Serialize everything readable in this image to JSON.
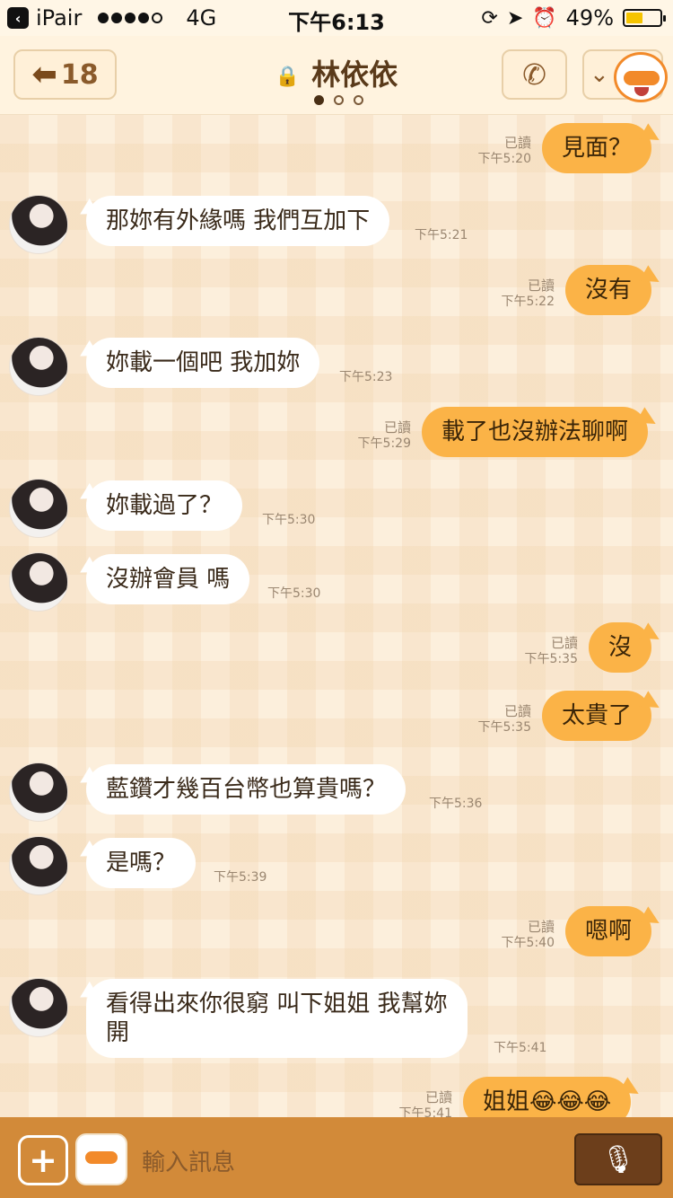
{
  "status_bar": {
    "back_app": "iPair",
    "carrier_network": "4G",
    "time": "下午6:13",
    "battery_percent": "49%",
    "battery_level": 0.49
  },
  "header": {
    "back_count": "18",
    "title": "林依依",
    "icons": {
      "back": "back-arrow-icon",
      "call": "phone-icon",
      "more": "chevron-down-icon",
      "lock": "lock-icon"
    }
  },
  "messages": [
    {
      "side": "out",
      "text": "見面？",
      "status": "已讀",
      "time": "下午5:20"
    },
    {
      "side": "in",
      "text": "那妳有外緣嗎  我們互加下",
      "time": "下午5:21"
    },
    {
      "side": "out",
      "text": "沒有",
      "status": "已讀",
      "time": "下午5:22"
    },
    {
      "side": "in",
      "text": "妳載一個吧 我加妳",
      "time": "下午5:23"
    },
    {
      "side": "out",
      "text": "載了也沒辦法聊啊",
      "status": "已讀",
      "time": "下午5:29"
    },
    {
      "side": "in",
      "text": "妳載過了？",
      "time": "下午5:30"
    },
    {
      "side": "in",
      "text": "沒辦會員 嗎",
      "time": "下午5:30"
    },
    {
      "side": "out",
      "text": "沒",
      "status": "已讀",
      "time": "下午5:35"
    },
    {
      "side": "out",
      "text": "太貴了",
      "status": "已讀",
      "time": "下午5:35"
    },
    {
      "side": "in",
      "text": "藍鑽才幾百台幣也算貴嗎？",
      "time": "下午5:36"
    },
    {
      "side": "in",
      "text": "是嗎？",
      "time": "下午5:39"
    },
    {
      "side": "out",
      "text": "嗯啊",
      "status": "已讀",
      "time": "下午5:40"
    },
    {
      "side": "in",
      "text_line1": "看得出來你很窮  叫下姐姐 我幫妳",
      "text_line2": "開",
      "time": "下午5:41"
    },
    {
      "side": "out",
      "text": "姐姐😂😂😂",
      "status": "已讀",
      "time": "下午5:41"
    }
  ],
  "input": {
    "placeholder": "輸入訊息",
    "icons": {
      "plus": "plus-icon",
      "sticker": "sticker-icon",
      "mic": "microphone-icon"
    }
  },
  "colors": {
    "out_bubble": "#fbb347",
    "in_bubble": "#ffffff",
    "input_bar": "#d28a39",
    "mic_button": "#6c3e1b"
  }
}
